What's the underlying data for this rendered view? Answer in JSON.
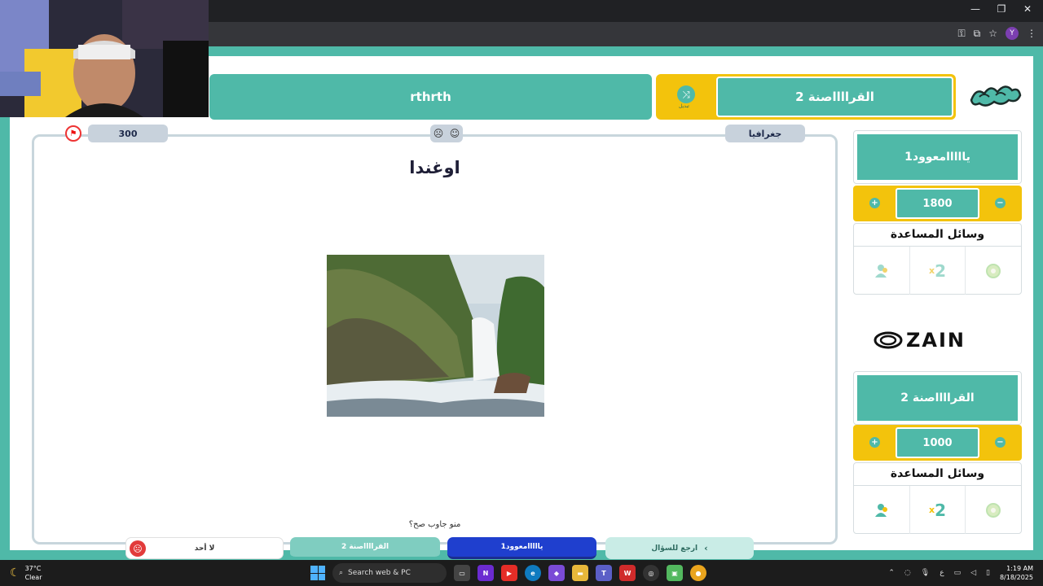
{
  "browser": {
    "window_controls": [
      "—",
      "❐",
      "✕"
    ],
    "avatar_letter": "Y"
  },
  "header": {
    "team_left_name": "rthrth",
    "team_right_name": "القرااااصنة 2",
    "swap_label": "تبديل"
  },
  "question": {
    "points": "300",
    "category": "جغرافيا",
    "title": "اوغندا",
    "prompt": "منو جاوب صح؟",
    "image_subject": "waterfall"
  },
  "answers": {
    "none": "لا أحد",
    "team2": "القرااااصنة 2",
    "team1": "يااااامعوود1",
    "back": "ارجع للسؤال"
  },
  "teams": [
    {
      "name": "يااااامعوود1",
      "score": "1800",
      "helps_title": "وسائل المساعدة",
      "helps": [
        "person-help-icon",
        "double-icon",
        "timer-icon"
      ]
    },
    {
      "name": "القرااااصنة 2",
      "score": "1000",
      "helps_title": "وسائل المساعدة",
      "helps": [
        "person-help-icon",
        "double-icon",
        "timer-icon"
      ]
    }
  ],
  "sponsor": "ZAIN",
  "colors": {
    "teal": "#4fb9a8",
    "yellow": "#f3c30c",
    "blue": "#1f3fce",
    "red": "#e23b3b"
  },
  "taskbar": {
    "temperature": "37°C",
    "condition": "Clear",
    "search_placeholder": "Search web & PC",
    "time": "1:19 AM",
    "date": "8/18/2025",
    "lang": "ع"
  }
}
